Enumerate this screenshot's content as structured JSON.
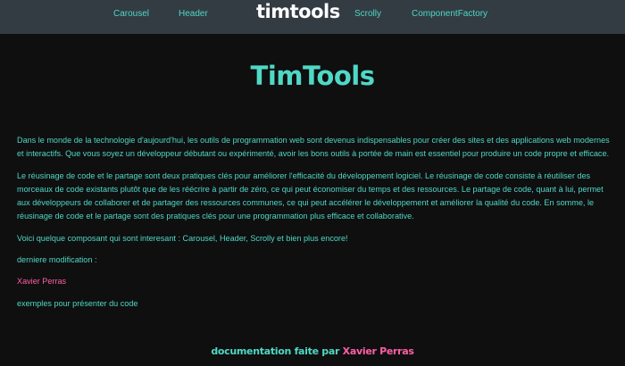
{
  "nav": {
    "links": [
      "Carousel",
      "Header",
      "Scrolly",
      "ComponentFactory"
    ],
    "logo": "timtools"
  },
  "main": {
    "title": "TimTools",
    "paragraphs": [
      "Dans le monde de la technologie d'aujourd'hui, les outils de programmation web sont devenus indispensables pour créer des sites et des applications web modernes et interactifs. Que vous soyez un développeur débutant ou expérimenté, avoir les bons outils à portée de main est essentiel pour produire un code propre et efficace.",
      "Le réusinage de code et le partage sont deux pratiques clés pour améliorer l'efficacité du développement logiciel. Le réusinage de code consiste à réutiliser des morceaux de code existants plutôt que de les réécrire à partir de zéro, ce qui peut économiser du temps et des ressources. Le partage de code, quant à lui, permet aux développeurs de collaborer et de partager des ressources communes, ce qui peut accélérer le développement et améliorer la qualité du code. En somme, le réusinage de code et le partage sont des pratiques clés pour une programmation plus efficace et collaborative.",
      "Voici quelque composant qui sont interesant : Carousel, Header, Scrolly et bien plus encore!"
    ],
    "modified_label": "derniere modification :",
    "author": "Xavier Perras",
    "examples_text": "exemples pour présenter du code"
  },
  "footer": {
    "prefix": "documentation faite par",
    "author": "Xavier Perras"
  },
  "colors": {
    "accent": "#4fd8c6",
    "author": "#ff5fa8",
    "nav_bg": "#333b43",
    "page_bg": "#0f0f0f"
  }
}
